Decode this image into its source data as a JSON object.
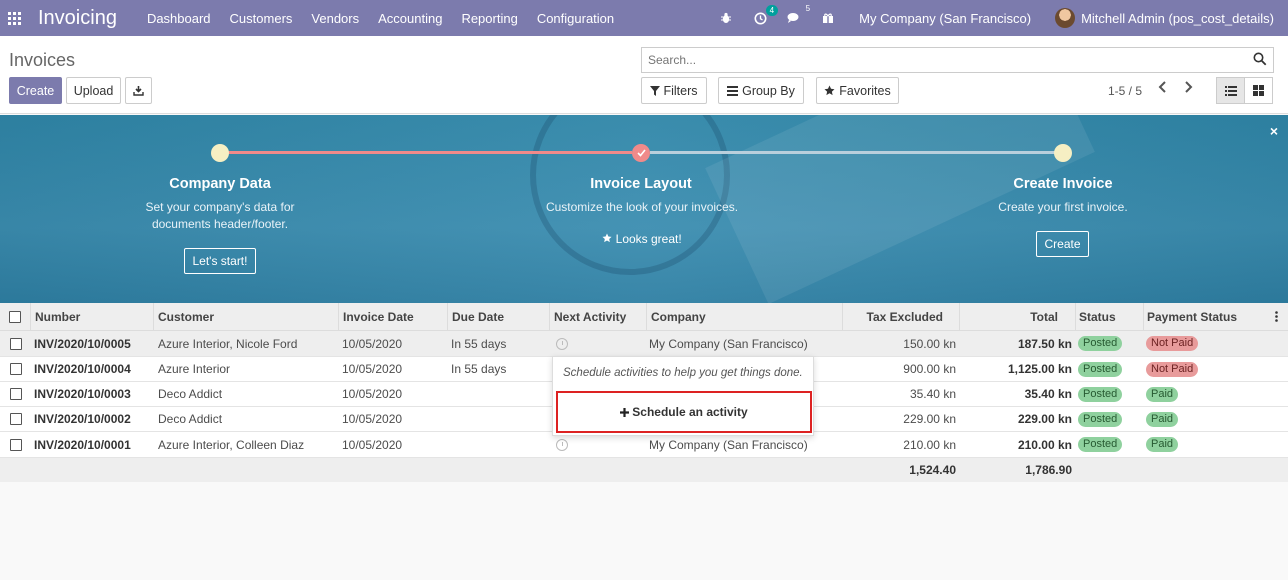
{
  "navbar": {
    "app_name": "Invoicing",
    "menu": [
      "Dashboard",
      "Customers",
      "Vendors",
      "Accounting",
      "Reporting",
      "Configuration"
    ],
    "activity_badge": "4",
    "messages_badge": "5",
    "company": "My Company (San Francisco)",
    "user": "Mitchell Admin (pos_cost_details)"
  },
  "control_panel": {
    "breadcrumb": "Invoices",
    "create_label": "Create",
    "upload_label": "Upload",
    "search_placeholder": "Search...",
    "filters_label": "Filters",
    "group_by_label": "Group By",
    "favorites_label": "Favorites",
    "pager": "1-5 / 5"
  },
  "onboarding": {
    "steps": [
      {
        "title": "Company Data",
        "desc": "Set your company's data for documents header/footer.",
        "button": "Let's start!"
      },
      {
        "title": "Invoice Layout",
        "desc": "Customize the look of your invoices.",
        "done_text": "Looks great!"
      },
      {
        "title": "Create Invoice",
        "desc": "Create your first invoice.",
        "button": "Create"
      }
    ]
  },
  "table": {
    "columns": [
      "Number",
      "Customer",
      "Invoice Date",
      "Due Date",
      "Next Activity",
      "Company",
      "Tax Excluded",
      "Total",
      "Status",
      "Payment Status"
    ],
    "rows": [
      {
        "number": "INV/2020/10/0005",
        "customer": "Azure Interior, Nicole Ford",
        "invoice_date": "10/05/2020",
        "due_date": "In 55 days",
        "company": "My Company (San Francisco)",
        "tax_excluded": "150.00 kn",
        "total": "187.50 kn",
        "status": "Posted",
        "payment_status": "Not Paid"
      },
      {
        "number": "INV/2020/10/0004",
        "customer": "Azure Interior",
        "invoice_date": "10/05/2020",
        "due_date": "In 55 days",
        "company": "",
        "tax_excluded": "900.00 kn",
        "total": "1,125.00 kn",
        "status": "Posted",
        "payment_status": "Not Paid"
      },
      {
        "number": "INV/2020/10/0003",
        "customer": "Deco Addict",
        "invoice_date": "10/05/2020",
        "due_date": "",
        "company": "",
        "tax_excluded": "35.40 kn",
        "total": "35.40 kn",
        "status": "Posted",
        "payment_status": "Paid"
      },
      {
        "number": "INV/2020/10/0002",
        "customer": "Deco Addict",
        "invoice_date": "10/05/2020",
        "due_date": "",
        "company": "",
        "tax_excluded": "229.00 kn",
        "total": "229.00 kn",
        "status": "Posted",
        "payment_status": "Paid"
      },
      {
        "number": "INV/2020/10/0001",
        "customer": "Azure Interior, Colleen Diaz",
        "invoice_date": "10/05/2020",
        "due_date": "",
        "company": "My Company (San Francisco)",
        "tax_excluded": "210.00 kn",
        "total": "210.00 kn",
        "status": "Posted",
        "payment_status": "Paid"
      }
    ],
    "footer": {
      "tax_excluded": "1,524.40",
      "total": "1,786.90"
    }
  },
  "popover": {
    "text": "Schedule activities to help you get things done.",
    "button": "Schedule an activity"
  },
  "colors": {
    "brand": "#7c7bad",
    "posted": "#8fd19e",
    "not_paid": "#e89b9b",
    "highlight": "#dd2222"
  }
}
